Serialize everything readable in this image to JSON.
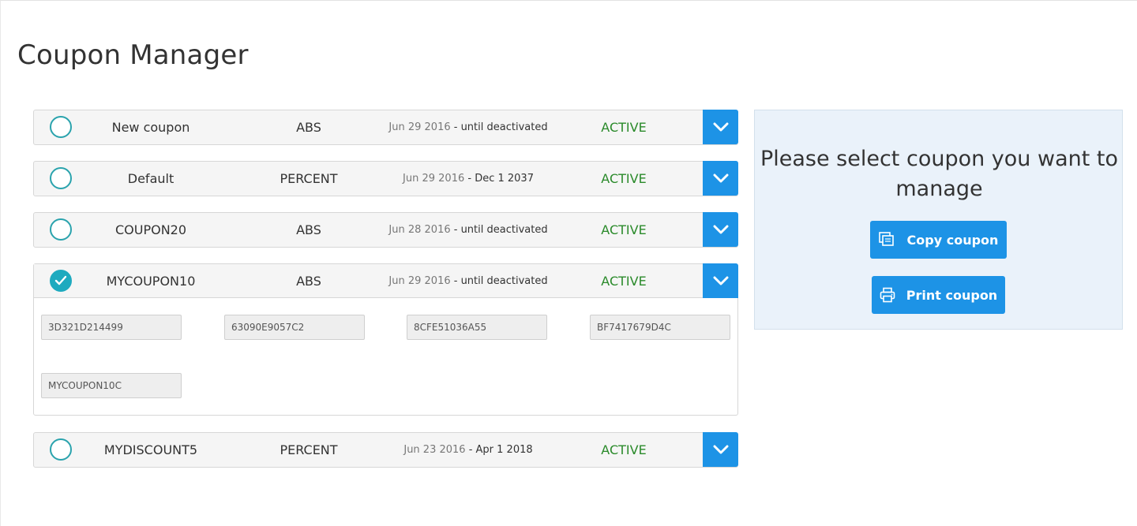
{
  "page": {
    "title": "Coupon Manager"
  },
  "coupons": [
    {
      "name": "New coupon",
      "type": "ABS",
      "date_start": "Jun 29 2016",
      "date_end": " - until deactivated",
      "status": "ACTIVE",
      "selected": false
    },
    {
      "name": "Default",
      "type": "PERCENT",
      "date_start": "Jun 29 2016",
      "date_end": " - Dec 1 2037",
      "status": "ACTIVE",
      "selected": false
    },
    {
      "name": "COUPON20",
      "type": "ABS",
      "date_start": "Jun 28 2016",
      "date_end": " - until deactivated",
      "status": "ACTIVE",
      "selected": false
    },
    {
      "name": "MYCOUPON10",
      "type": "ABS",
      "date_start": "Jun 29 2016",
      "date_end": " - until deactivated",
      "status": "ACTIVE",
      "selected": true,
      "codes": [
        "3D321D214499",
        "63090E9057C2",
        "8CFE51036A55",
        "BF7417679D4C",
        "MYCOUPON10C"
      ]
    },
    {
      "name": "MYDISCOUNT5",
      "type": "PERCENT",
      "date_start": "Jun 23 2016",
      "date_end": " - Apr 1 2018",
      "status": "ACTIVE",
      "selected": false
    }
  ],
  "side_panel": {
    "message": "Please select coupon you want to manage",
    "copy_label": "Copy coupon",
    "print_label": "Print coupon"
  },
  "icons": {
    "toggle": "chevron-down-icon",
    "check": "check-icon",
    "copy": "copy-icon",
    "print": "printer-icon"
  },
  "colors": {
    "accent": "#1d93e6",
    "status_active": "#2a8a2a",
    "radio": "#2aa3ad",
    "panel_bg": "#eaf2fa"
  }
}
